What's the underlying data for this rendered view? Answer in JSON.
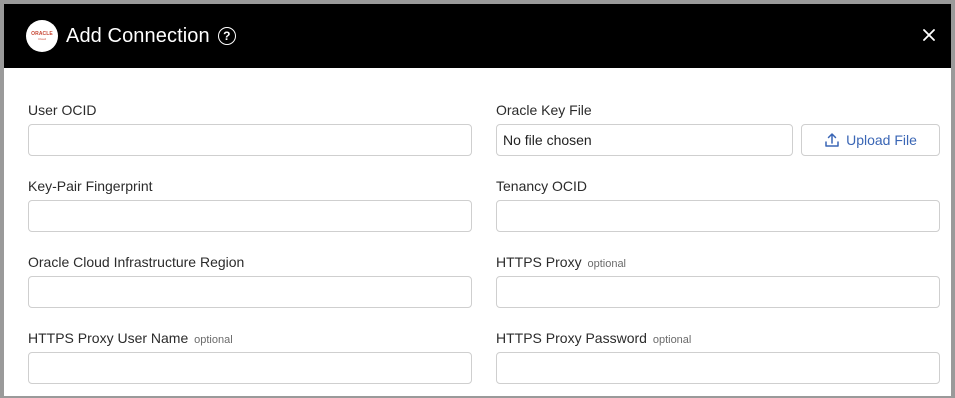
{
  "dialog": {
    "title": "Add Connection",
    "logo_text": "ORACLE",
    "logo_subtext": "Cloud"
  },
  "fields": {
    "user_ocid": {
      "label": "User OCID",
      "value": ""
    },
    "oracle_key_file": {
      "label": "Oracle Key File",
      "file_status": "No file chosen",
      "upload_label": "Upload File"
    },
    "key_pair_fingerprint": {
      "label": "Key-Pair Fingerprint",
      "value": ""
    },
    "tenancy_ocid": {
      "label": "Tenancy OCID",
      "value": ""
    },
    "region": {
      "label": "Oracle Cloud Infrastructure Region",
      "value": ""
    },
    "https_proxy": {
      "label": "HTTPS Proxy",
      "optional": "optional",
      "value": ""
    },
    "https_proxy_user": {
      "label": "HTTPS Proxy User Name",
      "optional": "optional",
      "value": ""
    },
    "https_proxy_password": {
      "label": "HTTPS Proxy Password",
      "optional": "optional",
      "value": ""
    }
  },
  "colors": {
    "header_bg": "#000000",
    "link_blue": "#3a66b5",
    "oracle_red": "#c74634"
  },
  "icons": {
    "help": "question-circle-icon",
    "close": "close-icon",
    "upload": "upload-icon"
  }
}
